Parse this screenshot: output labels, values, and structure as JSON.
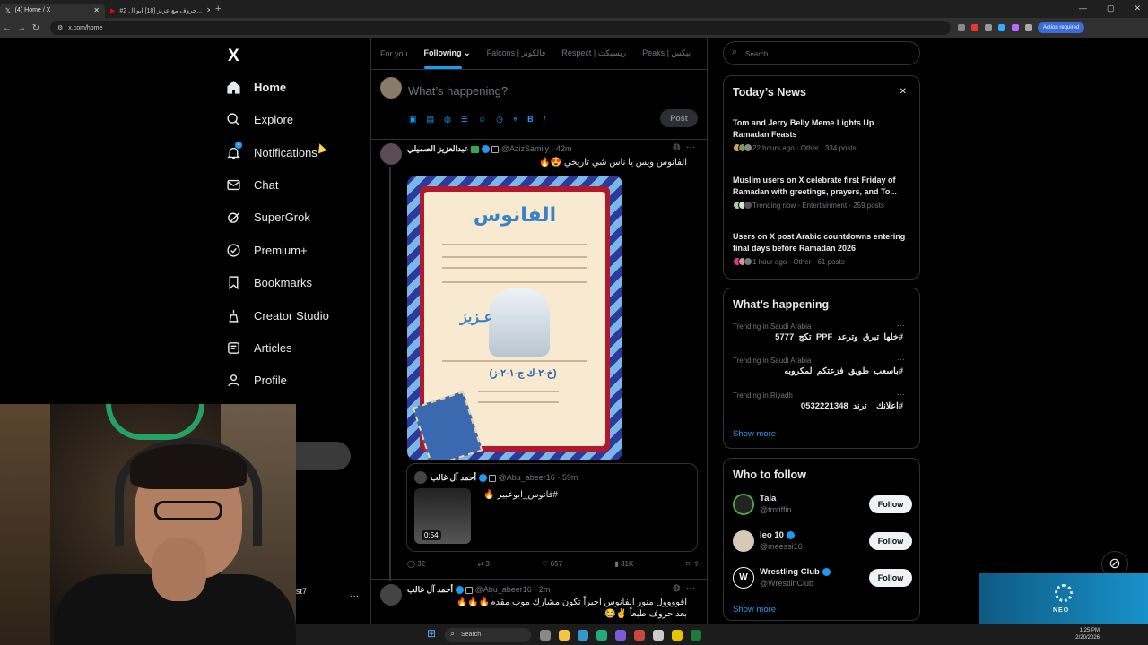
{
  "browser": {
    "tabs": [
      {
        "label": "(4) Home / X",
        "active": true
      },
      {
        "label": "#2 حروف مع عزيز [18] ابو ال...",
        "active": false
      }
    ],
    "new_tab": "+",
    "url": "x.com/home",
    "action_label": "Action required"
  },
  "sidebar": {
    "logo": "X",
    "items": [
      {
        "label": "Home",
        "icon": "home-icon"
      },
      {
        "label": "Explore",
        "icon": "search-icon"
      },
      {
        "label": "Notifications",
        "icon": "bell-icon",
        "badge": "4"
      },
      {
        "label": "Chat",
        "icon": "mail-icon"
      },
      {
        "label": "SuperGrok",
        "icon": "grok-icon"
      },
      {
        "label": "Premium+",
        "icon": "verified-icon"
      },
      {
        "label": "Bookmarks",
        "icon": "bookmark-icon"
      },
      {
        "label": "Creator Studio",
        "icon": "creator-icon"
      },
      {
        "label": "Articles",
        "icon": "article-icon"
      },
      {
        "label": "Profile",
        "icon": "person-icon"
      }
    ],
    "account_handle_partial": "st7",
    "more": "···"
  },
  "feed": {
    "tabs": [
      "For you",
      "Following",
      "Falcons | فالكونز",
      "Respect | ريسبكت",
      "Peaks | بيكس"
    ],
    "active_tab": "Following",
    "compose": {
      "placeholder": "What’s happening?",
      "post_label": "Post"
    },
    "tweets": [
      {
        "name": "عبدالعزيز الصميلي",
        "handle": "@AzizSamily",
        "time": "42m",
        "text": "الفانوس ويس يا ناس شي تاريخي 😍🔥",
        "poster": {
          "title": "الفانوس",
          "name": "عـزيز",
          "code": "(خ-٢-ك ج-١-٢-ز)"
        },
        "quote": {
          "name": "أحمد آل غالب",
          "handle": "@Abu_abeer16",
          "time": "59m",
          "text": "#فانوس_ابوعبير 🔥",
          "duration": "0:54"
        },
        "stats": {
          "replies": "32",
          "reposts": "3",
          "likes": "657",
          "views": "31K"
        }
      },
      {
        "name": "أحمد آل غالب",
        "handle": "@Abu_abeer16",
        "time": "2m",
        "text": "اقوووول منور الفانوس اخيراً تكون مشارك موب مقدم🔥🔥🔥",
        "text2": "بعد حروف طبعاً ✌️😂"
      }
    ]
  },
  "right": {
    "search_placeholder": "Search",
    "news": {
      "title": "Today’s News",
      "close": "✕",
      "items": [
        {
          "headline": "Tom and Jerry Belly Meme Lights Up Ramadan Feasts",
          "meta": "22 hours ago · Other · 334 posts"
        },
        {
          "headline": "Muslim users on X celebrate first Friday of Ramadan with greetings, prayers, and To...",
          "meta": "Trending now · Entertainment · 259 posts"
        },
        {
          "headline": "Users on X post Arabic countdowns entering final days before Ramadan 2026",
          "meta": "1 hour ago · Other · 61 posts"
        }
      ]
    },
    "happening": {
      "title": "What’s happening",
      "trends": [
        {
          "context": "Trending in Saudi Arabia",
          "tag": "#خلها_تبرق_وترعد_PPF_تكج_5777"
        },
        {
          "context": "Trending in Saudi Arabia",
          "tag": "#باسعب_طويق_فزعتكم_لمكروبه"
        },
        {
          "context": "Trending in Riyadh",
          "tag": "#اعلانك__ترند_0532221348"
        }
      ],
      "show_more": "Show more"
    },
    "who_to_follow": {
      "title": "Who to follow",
      "users": [
        {
          "name": "Tala",
          "handle": "@tmtiffin",
          "verified": false
        },
        {
          "name": "leo 10",
          "handle": "@meessi16",
          "verified": true
        },
        {
          "name": "Wrestling Club",
          "handle": "@WrestlinClub",
          "verified": true
        }
      ],
      "follow_label": "Follow",
      "show_more": "Show more"
    }
  },
  "taskbar": {
    "search": "Search",
    "time": "1:25 PM",
    "date": "2/20/2026"
  },
  "overlay": {
    "brand": "NEO"
  },
  "colors": {
    "accent": "#1d9bf0",
    "background": "#000000",
    "border": "#2f3336",
    "muted": "#71767b"
  }
}
